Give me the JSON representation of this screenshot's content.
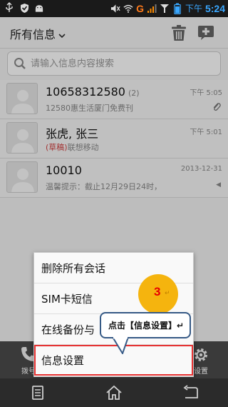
{
  "status_bar": {
    "network_label": "G",
    "time_period": "下午",
    "time": "5:24"
  },
  "header": {
    "title": "所有信息",
    "icons": [
      "chevron-down-icon",
      "trash-icon",
      "add-message-icon"
    ]
  },
  "search": {
    "placeholder": "请输入信息内容搜索"
  },
  "conversations": [
    {
      "name": "10658312580",
      "count": "(2)",
      "preview": "12580惠生活厦门免费刊",
      "draft": "",
      "time": "下午 5:05",
      "has_attachment": true
    },
    {
      "name": "张虎, 张三",
      "count": "",
      "preview": "联想移动",
      "draft": "(草稿)",
      "time": "下午 5:01",
      "has_attachment": false
    },
    {
      "name": "10010",
      "count": "",
      "preview": "温馨提示：截止12月29日24时，",
      "draft": "",
      "time": "2013-12-31",
      "has_attachment": false
    }
  ],
  "menu": {
    "items": [
      {
        "label": "删除所有会话"
      },
      {
        "label": "SIM卡短信"
      },
      {
        "label": "在线备份与"
      },
      {
        "label": "信息设置"
      }
    ]
  },
  "bottom_tabs": {
    "dial_label": "拨号",
    "settings_label": "设置"
  },
  "annotation": {
    "step_number": "3",
    "step_mark": "↵",
    "callout_text": "点击【信息设置】↵"
  },
  "colors": {
    "highlight": "#e53131",
    "step_circle": "#f5b40e",
    "callout_border": "#365a86"
  }
}
